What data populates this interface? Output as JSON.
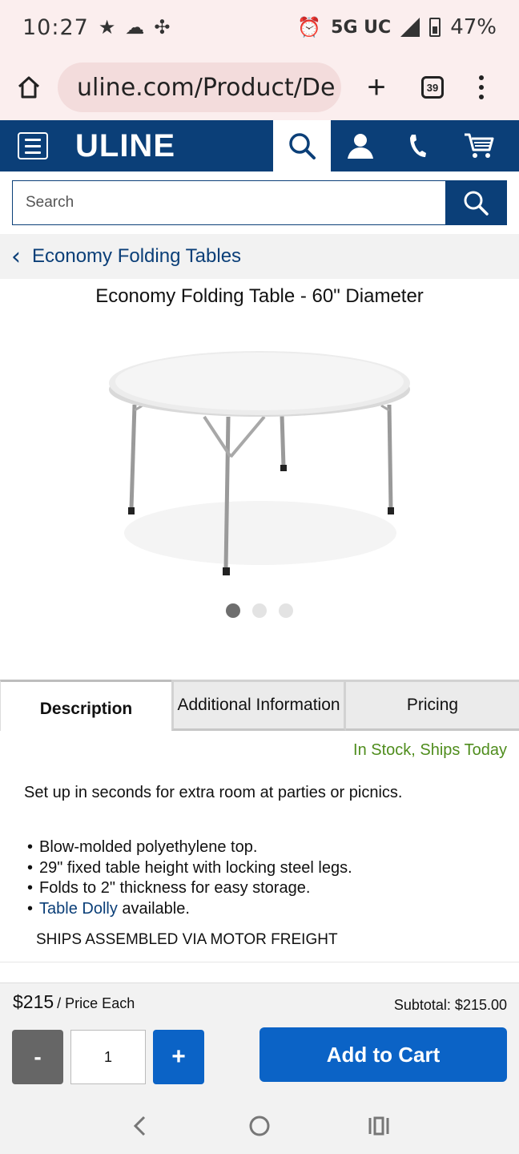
{
  "status_bar": {
    "time": "10:27",
    "network": "5G UC",
    "battery": "47%"
  },
  "browser": {
    "url": "uline.com/Product/De",
    "tab_count": "39"
  },
  "header": {
    "logo": "ULINE"
  },
  "search": {
    "placeholder": "Search"
  },
  "breadcrumb": {
    "label": "Economy Folding Tables"
  },
  "product": {
    "title": "Economy Folding Table - 60\" Diameter",
    "image_count": 3,
    "active_image": 1
  },
  "tabs": {
    "description": "Description",
    "additional": "Additional Information",
    "pricing": "Pricing"
  },
  "details": {
    "stock": "In Stock, Ships Today",
    "intro": "Set up in seconds for extra room at parties or picnics.",
    "bullet_1": "Blow-molded polyethylene top.",
    "bullet_2": "29\" fixed table height with locking steel legs.",
    "bullet_3": "Folds to 2\" thickness for easy storage.",
    "bullet_4_link": "Table Dolly",
    "bullet_4_rest": " available.",
    "shipping": "SHIPS ASSEMBLED VIA MOTOR FREIGHT"
  },
  "purchase": {
    "price": "$215",
    "price_unit": "/ Price Each",
    "subtotal": "Subtotal: $215.00",
    "minus": "-",
    "quantity": "1",
    "plus": "+",
    "add_to_cart": "Add to Cart"
  },
  "colors": {
    "brand_navy": "#0b3f78",
    "button_blue": "#0b63c6",
    "stock_green": "#4f8d1d"
  }
}
